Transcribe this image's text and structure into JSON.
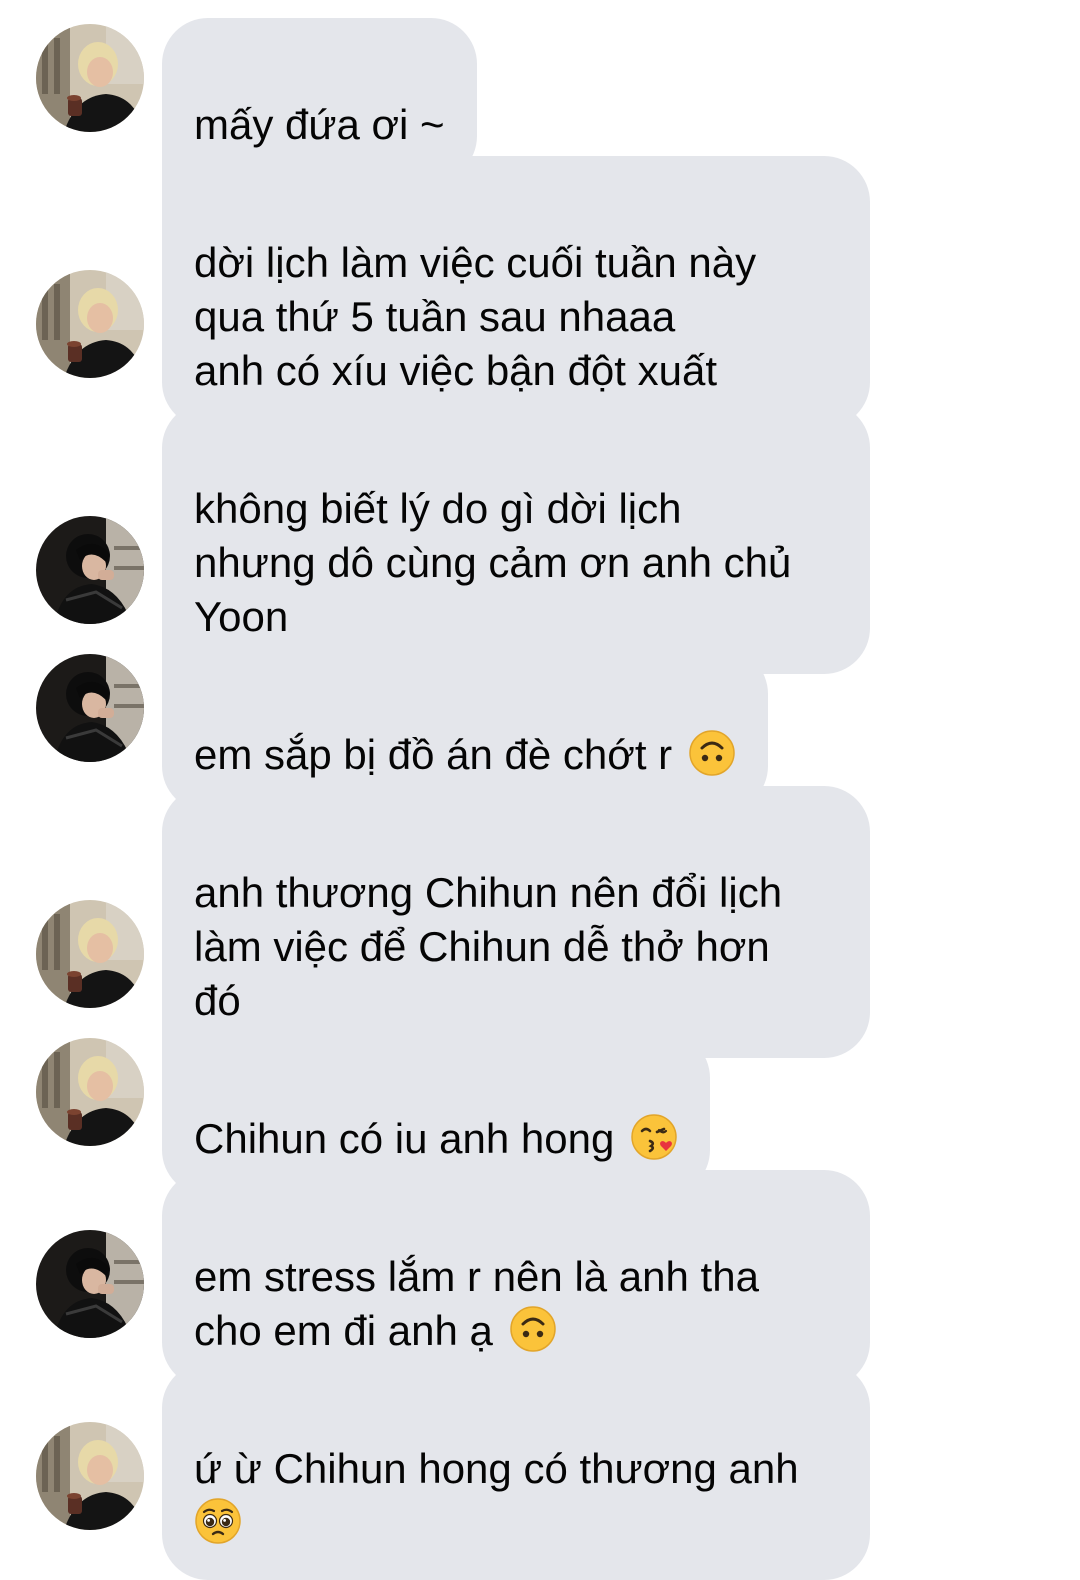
{
  "messages": [
    {
      "sender": "blonde",
      "text": "mấy đứa ơi ~",
      "emoji": null
    },
    {
      "sender": "blonde",
      "text": "dời lịch làm việc cuối tuần này\nqua thứ 5 tuần sau nhaaa\nanh có xíu việc bận đột xuất",
      "emoji": null
    },
    {
      "sender": "dark",
      "text": "không biết lý do gì dời lịch\nnhưng dô cùng cảm ơn anh chủ\nYoon",
      "emoji": null
    },
    {
      "sender": "dark",
      "text": "em sắp bị đồ án đè chớt r ",
      "emoji": "upside-down-face-icon"
    },
    {
      "sender": "blonde",
      "text": "anh thương Chihun nên đổi lịch\nlàm việc để Chihun dễ thở hơn\nđó",
      "emoji": null
    },
    {
      "sender": "blonde",
      "text": "Chihun có iu anh hong ",
      "emoji": "face-blowing-kiss-icon"
    },
    {
      "sender": "dark",
      "text": "em stress lắm r nên là anh tha\ncho em đi anh ạ ",
      "emoji": "upside-down-face-icon"
    },
    {
      "sender": "blonde",
      "text": "ứ ừ Chihun hong có thương anh\n",
      "emoji": "pleading-face-icon"
    }
  ],
  "colors": {
    "bubble": "#e4e6eb",
    "text": "#050505",
    "background": "#ffffff",
    "emoji_yellow": "#fbc33a"
  }
}
